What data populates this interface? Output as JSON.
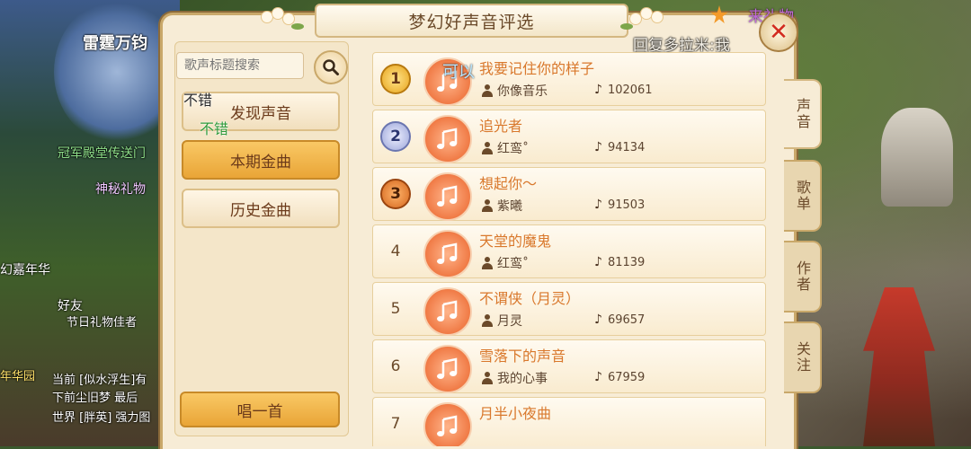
{
  "window": {
    "title": "梦幻好声音评选"
  },
  "overlay": {
    "gift": "来礼物",
    "reply": "回复多拉米:我",
    "float_1": "可以",
    "float_2": "不错",
    "float_3": "不错"
  },
  "background": {
    "banner": "雷霆万钧",
    "portal": "冠军殿堂传送门",
    "mystery_gift": "神秘礼物",
    "carnival": "幻嘉年华",
    "friends": "好友",
    "festival": "节日礼物佳者",
    "chat_lines": [
      "年华园",
      "当前 [似水浮生]有",
      "下前尘旧梦 最后",
      "世界 [胖英] 强力图"
    ]
  },
  "search": {
    "placeholder": "歌声标题搜索"
  },
  "menu": {
    "items": [
      {
        "label": "发现声音"
      },
      {
        "label": "本期金曲"
      },
      {
        "label": "历史金曲"
      }
    ],
    "active_index": 1
  },
  "sing_button": {
    "label": "唱一首"
  },
  "songs": [
    {
      "rank": "1",
      "title": "我要记住你的样子",
      "author": "你像音乐",
      "plays": "102061"
    },
    {
      "rank": "2",
      "title": "追光者",
      "author": "红鸾˚",
      "plays": "94134"
    },
    {
      "rank": "3",
      "title": "想起你～",
      "author": "紫曦",
      "plays": "91503"
    },
    {
      "rank": "4",
      "title": "天堂的魔鬼",
      "author": "红鸾˚",
      "plays": "81139"
    },
    {
      "rank": "5",
      "title": "不谓侠（月灵）",
      "author": "月灵",
      "plays": "69657"
    },
    {
      "rank": "6",
      "title": "雪落下的声音",
      "author": "我的心事",
      "plays": "67959"
    },
    {
      "rank": "7",
      "title": "月半小夜曲",
      "author": "",
      "plays": ""
    }
  ],
  "tabs": [
    {
      "label": "声音"
    },
    {
      "label": "歌单"
    },
    {
      "label": "作者"
    },
    {
      "label": "关注"
    }
  ],
  "active_tab": 0,
  "colors": {
    "accent": "#e9a537",
    "title_text": "#d9782c",
    "panel_bg": "#f7ecd6",
    "close_x": "#d22a1f"
  }
}
